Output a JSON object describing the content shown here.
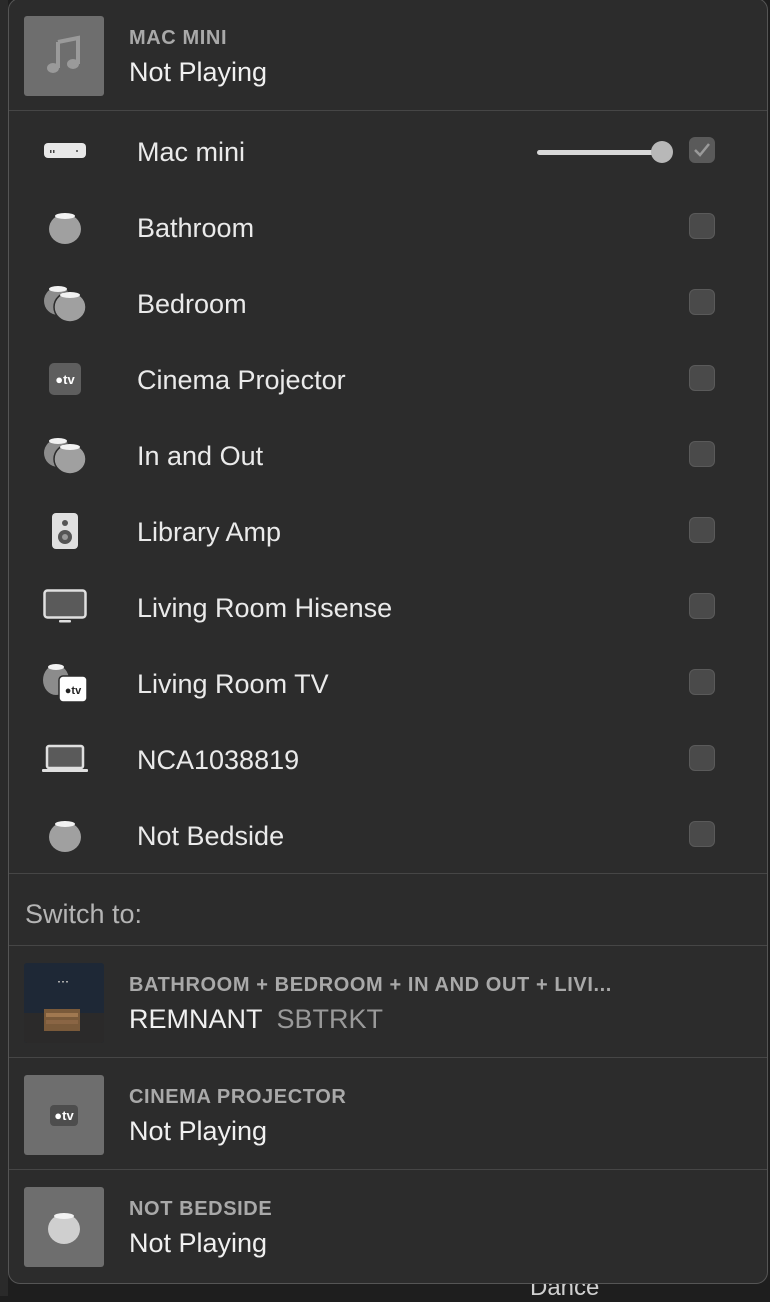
{
  "header": {
    "source_label": "MAC MINI",
    "status": "Not Playing",
    "art_icon": "music-note-icon"
  },
  "devices": [
    {
      "name": "Mac mini",
      "icon": "mac-mini-icon",
      "checked": true,
      "volume": 1.0
    },
    {
      "name": "Bathroom",
      "icon": "homepod-mini-icon",
      "checked": false
    },
    {
      "name": "Bedroom",
      "icon": "homepod-pair-icon",
      "checked": false
    },
    {
      "name": "Cinema Projector",
      "icon": "apple-tv-icon",
      "checked": false
    },
    {
      "name": "In and Out",
      "icon": "homepod-pair-icon",
      "checked": false
    },
    {
      "name": "Library Amp",
      "icon": "speaker-icon",
      "checked": false
    },
    {
      "name": "Living Room Hisense",
      "icon": "tv-monitor-icon",
      "checked": false
    },
    {
      "name": "Living Room TV",
      "icon": "homepod-appletv-icon",
      "checked": false
    },
    {
      "name": "NCA1038819",
      "icon": "laptop-icon",
      "checked": false
    },
    {
      "name": "Not Bedside",
      "icon": "homepod-mini-icon",
      "checked": false
    }
  ],
  "switch_to": {
    "label": "Switch to:",
    "items": [
      {
        "source": "BATHROOM + BEDROOM + IN AND OUT + LIVI...",
        "title": "REMNANT",
        "artist": "SBTRKT",
        "art": "album-art"
      },
      {
        "source": "CINEMA PROJECTOR",
        "title": "Not Playing",
        "artist": "",
        "art": "apple-tv-icon"
      },
      {
        "source": "NOT BEDSIDE",
        "title": "Not Playing",
        "artist": "",
        "art": "homepod-mini-icon"
      }
    ]
  },
  "atv_label": "tv",
  "background_text": "Dance",
  "colors": {
    "panel": "#2c2c2c",
    "checkbox": "#4a4a4a",
    "art_bg": "#6e6e6e"
  }
}
